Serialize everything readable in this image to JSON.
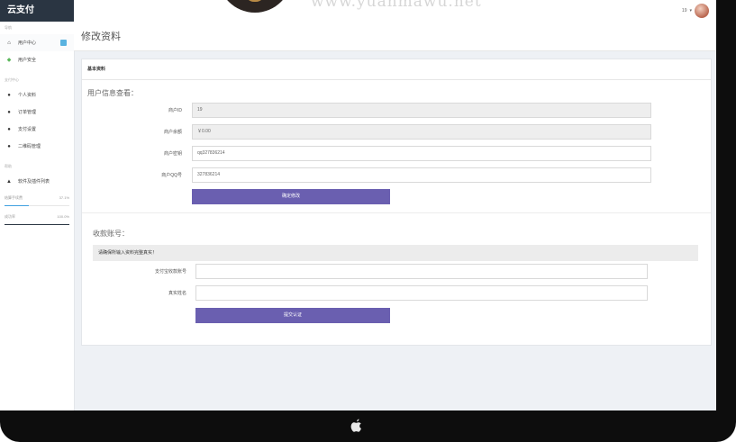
{
  "watermark": {
    "text": "www.yuanmawu.net"
  },
  "sidebar": {
    "brand": "云支付",
    "section1": "导航",
    "items1": [
      {
        "label": "用户中心",
        "icon": "home-icon"
      },
      {
        "label": "用户安全",
        "icon": "shield-icon"
      }
    ],
    "section2": "支付中心",
    "items2": [
      {
        "label": "个人资料",
        "icon": "user-icon"
      },
      {
        "label": "订单管理",
        "icon": "list-icon"
      },
      {
        "label": "支付设置",
        "icon": "gear-icon"
      },
      {
        "label": "二维码管理",
        "icon": "qr-icon"
      }
    ],
    "section3": "帮助",
    "items3": [
      {
        "label": "软件及插件列表",
        "icon": "download-icon"
      }
    ],
    "progress": [
      {
        "label": "结算手续费",
        "value": "37.1%",
        "fraction": 0.371
      },
      {
        "label": "成功率",
        "value": "100.0%",
        "fraction": 1.0
      }
    ]
  },
  "topbar": {
    "user_id": "19"
  },
  "page": {
    "title": "修改资料"
  },
  "card": {
    "header": "基本资料",
    "section_user": "用户信息查看：",
    "fields": [
      {
        "label": "商户ID",
        "value": "19"
      },
      {
        "label": "商户余额",
        "value": "￥0.00"
      },
      {
        "label": "商户密钥",
        "value": "qq327836214"
      },
      {
        "label": "商户QQ号",
        "value": "327836214"
      }
    ],
    "save_button": "确定修改",
    "section_settle": "收款账号：",
    "notice": "请确保所输入资料完整真实！",
    "settle_fields": [
      {
        "label": "支付宝收款账号",
        "value": ""
      },
      {
        "label": "真实姓名",
        "value": ""
      }
    ],
    "submit_button": "提交认证"
  }
}
